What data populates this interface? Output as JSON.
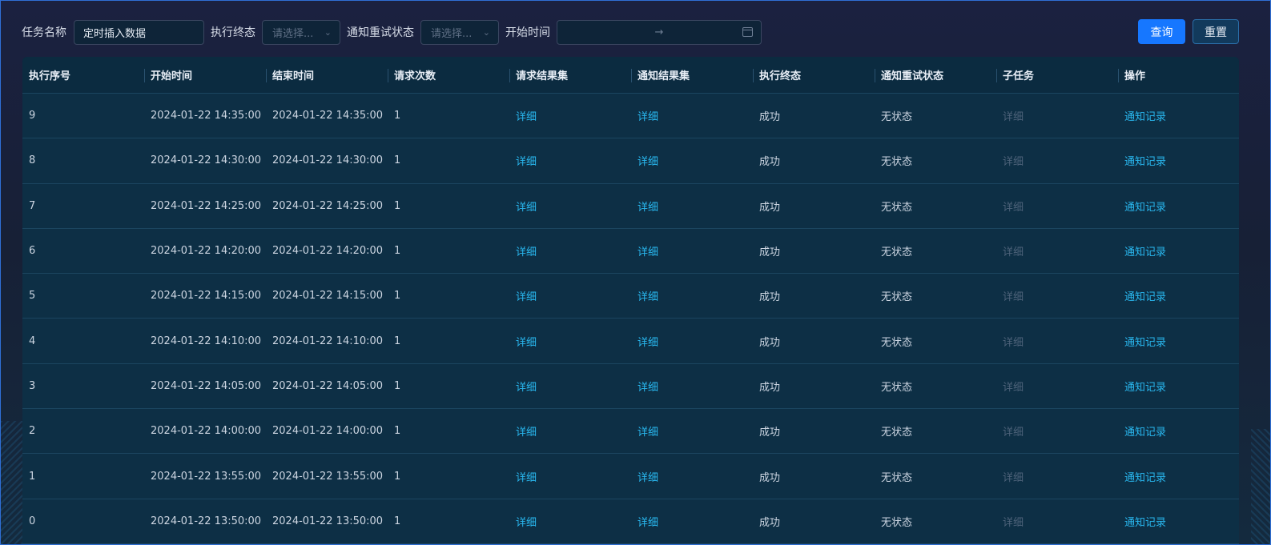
{
  "filters": {
    "task_name_label": "任务名称",
    "task_name_value": "定时插入数据",
    "exec_status_label": "执行终态",
    "exec_status_placeholder": "请选择...",
    "notify_retry_label": "通知重试状态",
    "notify_retry_placeholder": "请选择...",
    "start_time_label": "开始时间",
    "date_separator": "→"
  },
  "buttons": {
    "query": "查询",
    "reset": "重置"
  },
  "table": {
    "columns": [
      "执行序号",
      "开始时间",
      "结束时间",
      "请求次数",
      "请求结果集",
      "通知结果集",
      "执行终态",
      "通知重试状态",
      "子任务",
      "操作"
    ],
    "rows": [
      {
        "seq": "9",
        "start": "2024-01-22 14:35:00",
        "end": "2024-01-22 14:35:00",
        "count": "1",
        "req": "详细",
        "notify": "详细",
        "status": "成功",
        "retry": "无状态",
        "sub": "详细",
        "action": "通知记录"
      },
      {
        "seq": "8",
        "start": "2024-01-22 14:30:00",
        "end": "2024-01-22 14:30:00",
        "count": "1",
        "req": "详细",
        "notify": "详细",
        "status": "成功",
        "retry": "无状态",
        "sub": "详细",
        "action": "通知记录"
      },
      {
        "seq": "7",
        "start": "2024-01-22 14:25:00",
        "end": "2024-01-22 14:25:00",
        "count": "1",
        "req": "详细",
        "notify": "详细",
        "status": "成功",
        "retry": "无状态",
        "sub": "详细",
        "action": "通知记录"
      },
      {
        "seq": "6",
        "start": "2024-01-22 14:20:00",
        "end": "2024-01-22 14:20:00",
        "count": "1",
        "req": "详细",
        "notify": "详细",
        "status": "成功",
        "retry": "无状态",
        "sub": "详细",
        "action": "通知记录"
      },
      {
        "seq": "5",
        "start": "2024-01-22 14:15:00",
        "end": "2024-01-22 14:15:00",
        "count": "1",
        "req": "详细",
        "notify": "详细",
        "status": "成功",
        "retry": "无状态",
        "sub": "详细",
        "action": "通知记录"
      },
      {
        "seq": "4",
        "start": "2024-01-22 14:10:00",
        "end": "2024-01-22 14:10:00",
        "count": "1",
        "req": "详细",
        "notify": "详细",
        "status": "成功",
        "retry": "无状态",
        "sub": "详细",
        "action": "通知记录"
      },
      {
        "seq": "3",
        "start": "2024-01-22 14:05:00",
        "end": "2024-01-22 14:05:00",
        "count": "1",
        "req": "详细",
        "notify": "详细",
        "status": "成功",
        "retry": "无状态",
        "sub": "详细",
        "action": "通知记录"
      },
      {
        "seq": "2",
        "start": "2024-01-22 14:00:00",
        "end": "2024-01-22 14:00:00",
        "count": "1",
        "req": "详细",
        "notify": "详细",
        "status": "成功",
        "retry": "无状态",
        "sub": "详细",
        "action": "通知记录"
      },
      {
        "seq": "1",
        "start": "2024-01-22 13:55:00",
        "end": "2024-01-22 13:55:00",
        "count": "1",
        "req": "详细",
        "notify": "详细",
        "status": "成功",
        "retry": "无状态",
        "sub": "详细",
        "action": "通知记录"
      },
      {
        "seq": "0",
        "start": "2024-01-22 13:50:00",
        "end": "2024-01-22 13:50:00",
        "count": "1",
        "req": "详细",
        "notify": "详细",
        "status": "成功",
        "retry": "无状态",
        "sub": "详细",
        "action": "通知记录"
      }
    ]
  }
}
